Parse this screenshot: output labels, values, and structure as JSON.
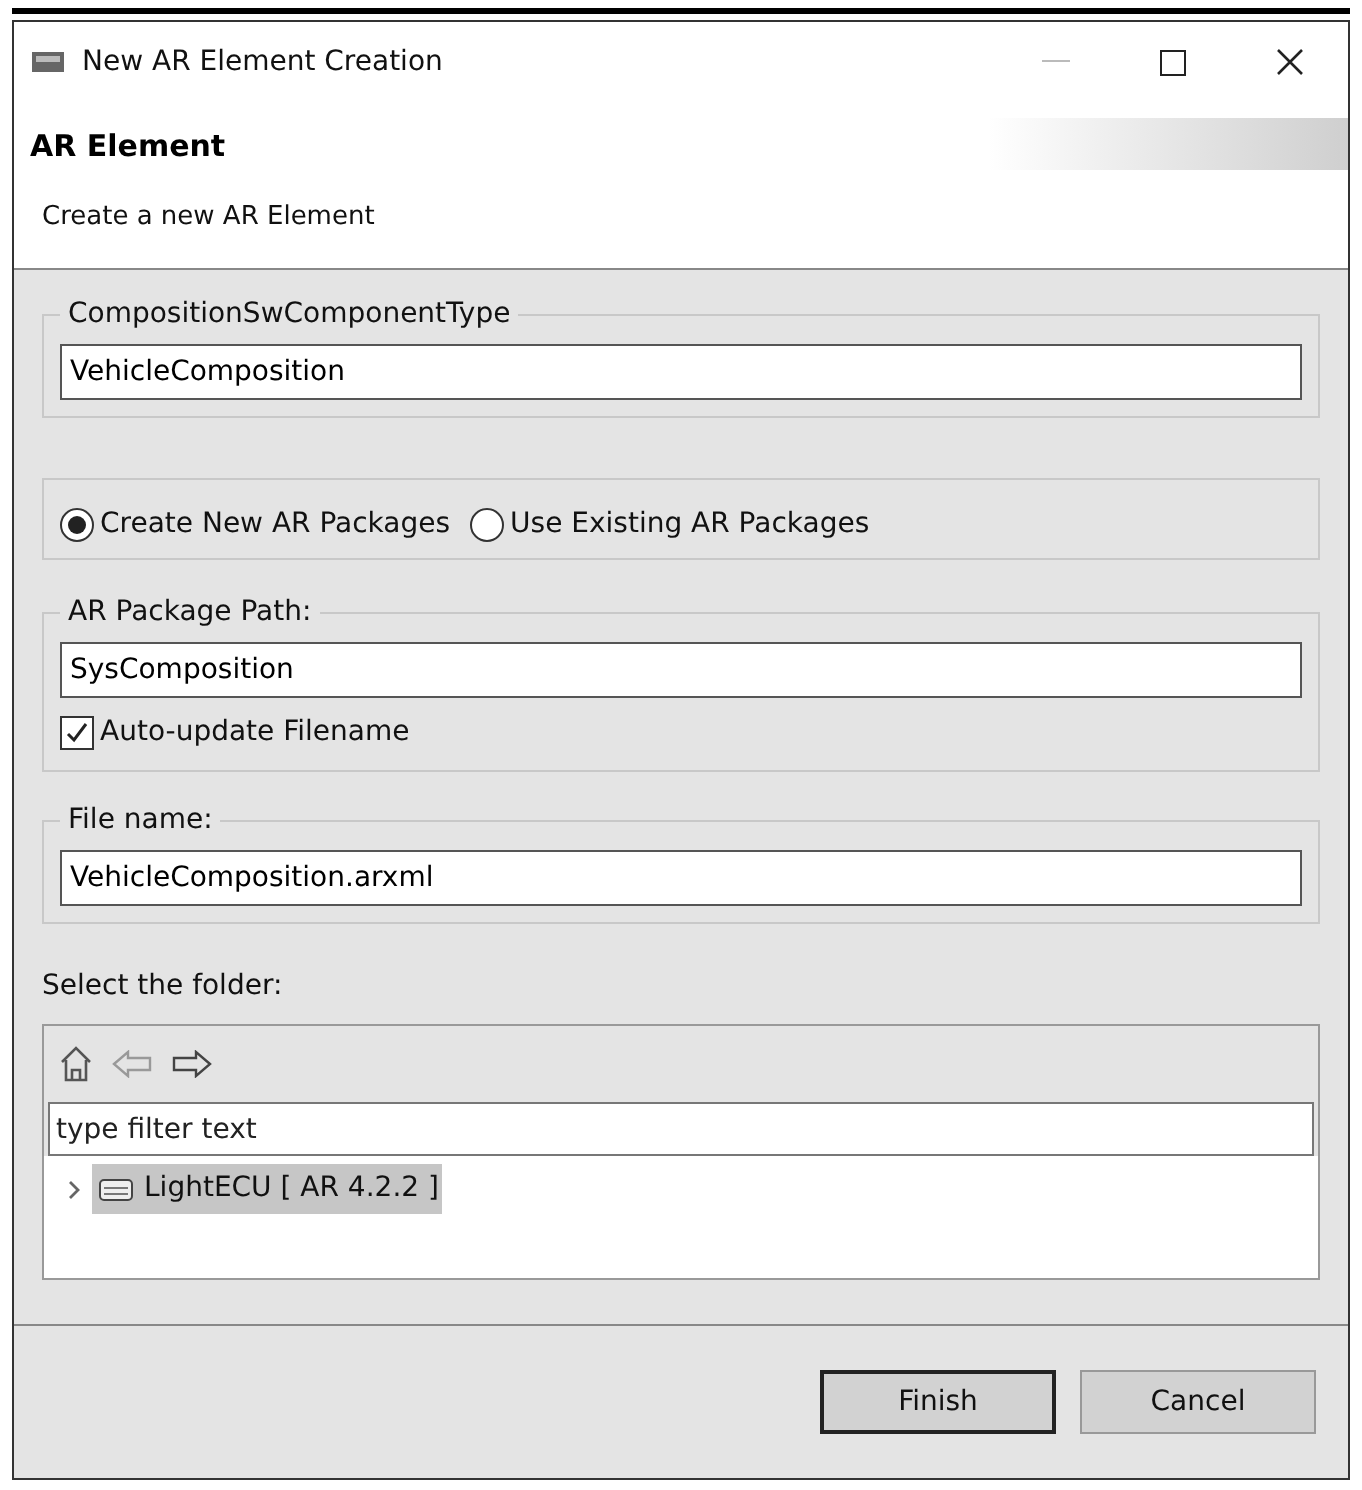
{
  "window": {
    "title": "New AR Element Creation"
  },
  "header": {
    "title": "AR Element",
    "description": "Create a new AR Element"
  },
  "component_group": {
    "legend": "CompositionSwComponentType",
    "value": "VehicleComposition"
  },
  "package_options": [
    {
      "label": "Create New AR Packages",
      "selected": true
    },
    {
      "label": "Use Existing AR Packages",
      "selected": false
    }
  ],
  "package_path_group": {
    "legend": "AR Package Path:",
    "value": "SysComposition",
    "auto_update": {
      "label": "Auto-update Filename",
      "checked": true
    }
  },
  "file_name_group": {
    "legend": "File name:",
    "value": "VehicleComposition.arxml"
  },
  "folder": {
    "label": "Select the folder:",
    "filter": {
      "placeholder": "type filter text"
    },
    "tree": [
      {
        "label": "LightECU [ AR 4.2.2 ]",
        "expanded": false,
        "selected": true
      }
    ]
  },
  "buttons": [
    {
      "label": "Finish",
      "default": true
    },
    {
      "label": "Cancel",
      "default": false
    }
  ]
}
